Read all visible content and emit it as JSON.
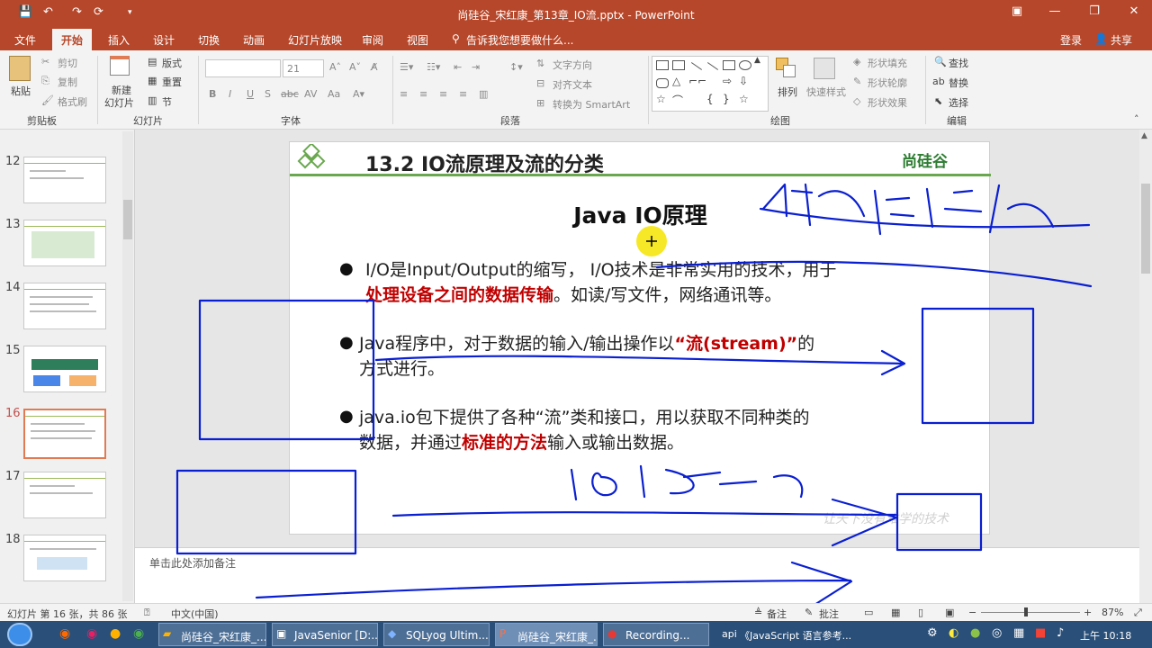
{
  "window": {
    "title": "尚硅谷_宋红康_第13章_IO流.pptx - PowerPoint",
    "accent": "#b7472a"
  },
  "qat": {
    "save_icon": "save-icon",
    "undo_icon": "undo-icon",
    "redo_icon": "redo-icon",
    "customize_icon": "customize-icon"
  },
  "tabs": [
    "文件",
    "开始",
    "插入",
    "设计",
    "切换",
    "动画",
    "幻灯片放映",
    "审阅",
    "视图"
  ],
  "tell_me": "告诉我您想要做什么...",
  "account": {
    "login": "登录",
    "share": "共享"
  },
  "ribbon": {
    "clipboard": {
      "paste": "粘贴",
      "cut": "剪切",
      "copy": "复制",
      "painter": "格式刷",
      "label": "剪贴板"
    },
    "slides": {
      "new_slide_1": "新建",
      "new_slide_2": "幻灯片",
      "layout": "版式",
      "reset": "重置",
      "section": "节",
      "label": "幻灯片"
    },
    "font": {
      "size": "21",
      "bold": "B",
      "italic": "I",
      "underline": "U",
      "shadow": "S",
      "strike": "abc",
      "spacing": "AV",
      "case": "Aa",
      "label": "字体"
    },
    "paragraph": {
      "direction": "文字方向",
      "align": "对齐文本",
      "smartart": "转换为 SmartArt",
      "label": "段落"
    },
    "drawing": {
      "arrange": "排列",
      "quick_styles": "快速样式",
      "fill": "形状填充",
      "outline": "形状轮廓",
      "effects": "形状效果",
      "label": "绘图"
    },
    "editing": {
      "find": "查找",
      "replace": "替换",
      "select": "选择",
      "label": "编辑"
    }
  },
  "thumbnails": [
    {
      "num": "12"
    },
    {
      "num": "13"
    },
    {
      "num": "14"
    },
    {
      "num": "15"
    },
    {
      "num": "16",
      "selected": true
    },
    {
      "num": "17"
    },
    {
      "num": "18"
    }
  ],
  "slide": {
    "title": "13.2 IO流原理及流的分类",
    "logo": "尚硅谷",
    "subtitle": "Java IO原理",
    "bullet1_a": "I/O是Input/Output的缩写，  I/O技术是非常实用的技术，用于",
    "bullet1_b": "处理设备之间的数据传输",
    "bullet1_c": "。如读/写文件，网络通讯等。",
    "bullet2_a": "Java程序中，对于数据的输入/输出操作以",
    "bullet2_b": "“流(stream)”",
    "bullet2_c": "的",
    "bullet2_d": "方式进行。",
    "bullet3_a": "java.io包下提供了各种“流”类和接口，用以获取不同种类的",
    "bullet3_b": "数据，并通过",
    "bullet3_c": "标准的方法",
    "bullet3_d": "输入或输出数据。",
    "watermark": "让天下没有难学的技术"
  },
  "notes": "单击此处添加备注",
  "status": {
    "slide_info": "幻灯片 第 16 张，共 86 张",
    "lang": "中文(中国)",
    "notes_btn": "备注",
    "comments_btn": "批注",
    "zoom": "87%"
  },
  "taskbar": {
    "items": [
      "尚硅谷_宋红康_...",
      "JavaSenior [D:...",
      "SQLyog Ultim...",
      "尚硅谷_宋红康_...",
      "Recording..."
    ],
    "api": "api",
    "browser": "《JavaScript 语言参考...",
    "clock": "上午 10:18"
  }
}
